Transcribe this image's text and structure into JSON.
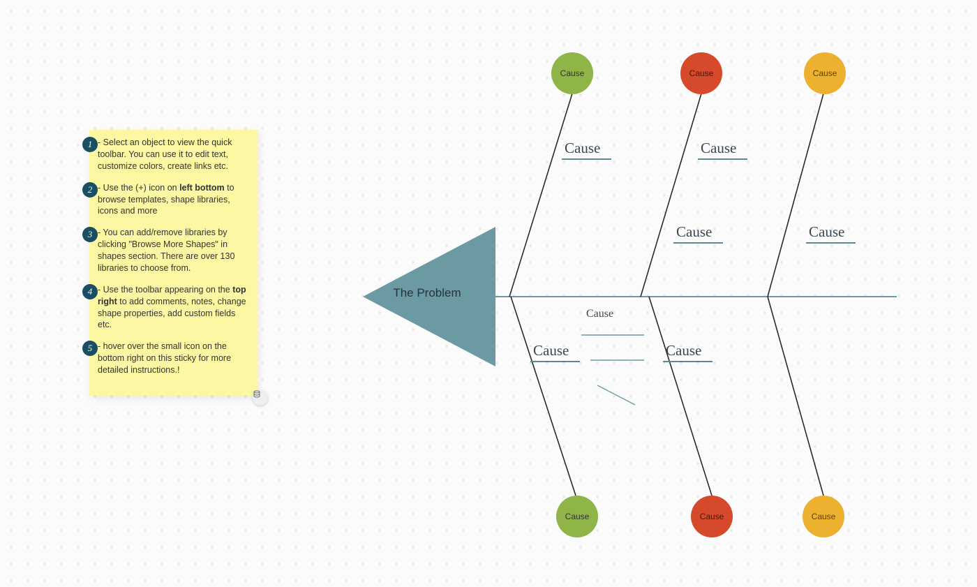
{
  "sticky": {
    "items": [
      {
        "num": "1",
        "text_pre": "- Select an object to view the quick toolbar. You can use it to edit text, customize colors, create links etc.",
        "bold": "",
        "text_post": ""
      },
      {
        "num": "2",
        "text_pre": "- Use the (+) icon on ",
        "bold": "left bottom",
        "text_post": " to browse templates, shape libraries, icons and more"
      },
      {
        "num": "3",
        "text_pre": "- You can add/remove libraries by clicking \"Browse More Shapes\" in shapes section. There are over 130 libraries to choose from.",
        "bold": "",
        "text_post": ""
      },
      {
        "num": "4",
        "text_pre": "- Use the toolbar appearing on the ",
        "bold": "top right",
        "text_post": " to add comments, notes, change shape properties, add custom fields etc."
      },
      {
        "num": "5",
        "text_pre": "- hover over the small icon on the bottom right on this sticky for more detailed instructions.!",
        "bold": "",
        "text_post": ""
      }
    ]
  },
  "diagram": {
    "problem_label": "The Problem",
    "top_circles": [
      {
        "label": "Cause"
      },
      {
        "label": "Cause"
      },
      {
        "label": "Cause"
      }
    ],
    "bottom_circles": [
      {
        "label": "Cause"
      },
      {
        "label": "Cause"
      },
      {
        "label": "Cause"
      }
    ],
    "branch_labels": {
      "top_left": "Cause",
      "top_mid": "Cause",
      "mid_mid": "Cause",
      "mid_right": "Cause",
      "bot_left": "Cause",
      "bot_mid": "Cause",
      "sub_small": "Cause"
    },
    "colors": {
      "spine": "#6b9aa3",
      "bone": "#2a2a2a",
      "head": "#6b9aa3",
      "green": "#8fb447",
      "red": "#d6492a",
      "yellow": "#ecb22f"
    }
  }
}
